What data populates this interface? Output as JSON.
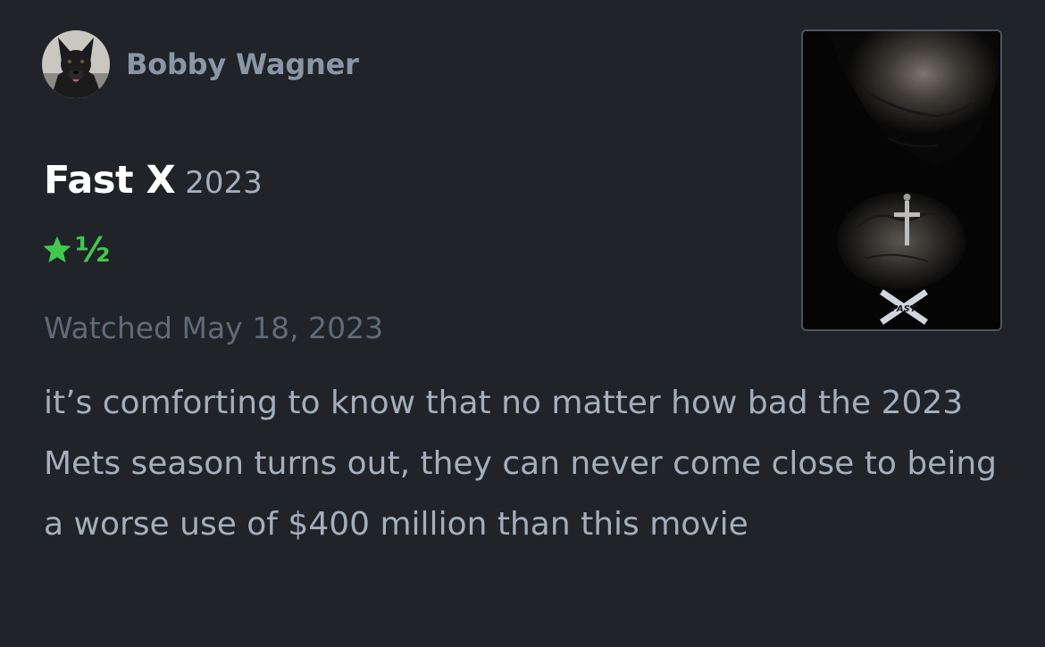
{
  "author": {
    "name": "Bobby Wagner",
    "avatar": "avatar-photo-dog"
  },
  "film": {
    "title": "Fast X",
    "year": "2023",
    "poster_logo": "FAST"
  },
  "rating": {
    "stars": 1.5,
    "half_glyph": "½",
    "icon": "star-icon",
    "color": "#40c94e"
  },
  "watched": {
    "text": "Watched May 18, 2023"
  },
  "review": {
    "body": "it’s comforting to know that no matter how bad the 2023 Mets season turns out, they can never come close to being a worse use of $400 million than this movie"
  },
  "colors": {
    "background": "#202327",
    "author_name": "#8996a6",
    "title": "#ffffff",
    "body_text": "#a3afbd",
    "meta_text": "#5e6b79",
    "poster_border": "#4a5562"
  }
}
